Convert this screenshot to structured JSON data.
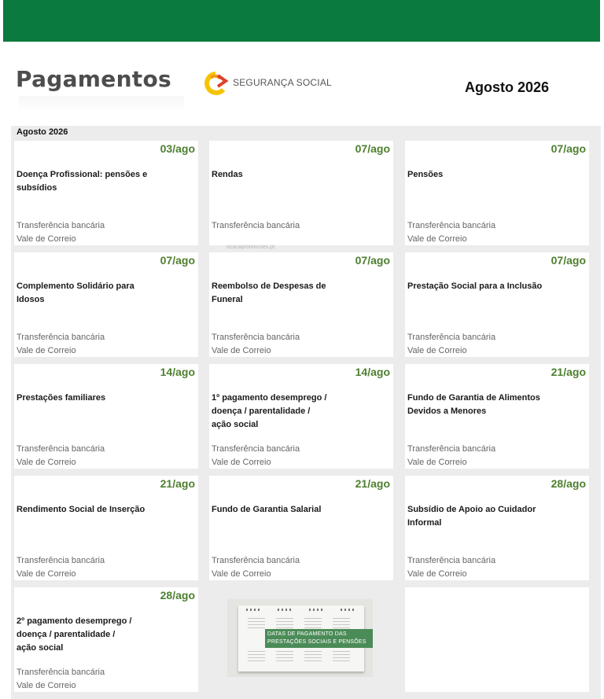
{
  "header": {
    "title": "Pagamentos",
    "logo_label": "SEGURANÇA SOCIAL",
    "month": "Agosto 2026"
  },
  "grid": {
    "label": "Agosto 2026",
    "cards": [
      {
        "date": "03/ago",
        "title": "Doença Profissional: pensões e\nsubsídios",
        "methods": [
          "Transferência bancária",
          "Vale de Correio"
        ]
      },
      {
        "date": "07/ago",
        "title": "Rendas",
        "methods": [
          "Transferência bancária"
        ]
      },
      {
        "date": "07/ago",
        "title": "Pensões",
        "methods": [
          "Transferência bancária",
          "Vale de Correio"
        ]
      },
      {
        "date": "07/ago",
        "title": "Complemento Solidário para\nIdosos",
        "methods": [
          "Transferência bancária",
          "Vale de Correio"
        ]
      },
      {
        "date": "07/ago",
        "title": "Reembolso de Despesas de\nFuneral",
        "methods": [
          "Transferência bancária",
          "Vale de Correio"
        ]
      },
      {
        "date": "07/ago",
        "title": "Prestação Social para a Inclusão",
        "methods": [
          "Transferência bancária",
          "Vale de Correio"
        ]
      },
      {
        "date": "14/ago",
        "title": "Prestações familiares",
        "methods": [
          "Transferência bancária",
          "Vale de Correio"
        ]
      },
      {
        "date": "14/ago",
        "title": "1º pagamento desemprego /\ndoença / parentalidade /\nação social",
        "methods": [
          "Transferência bancária",
          "Vale de Correio"
        ]
      },
      {
        "date": "21/ago",
        "title": "Fundo de Garantia de Alimentos\n Devidos a Menores",
        "methods": [
          "Transferência bancária",
          "Vale de Correio"
        ]
      },
      {
        "date": "21/ago",
        "title": "Rendimento Social de Inserção",
        "methods": [
          "Transferência bancária",
          "Vale de Correio"
        ]
      },
      {
        "date": "21/ago",
        "title": "Fundo de Garantia Salarial",
        "methods": [
          "Transferência bancária",
          "Vale de Correio"
        ]
      },
      {
        "date": "28/ago",
        "title": "Subsídio de Apoio ao Cuidador\n Informal",
        "methods": [
          "Transferência bancária",
          "Vale de Correio"
        ]
      },
      {
        "date": "28/ago",
        "title": "2º pagamento desemprego /\ndoença / parentalidade /\nação social",
        "methods": [
          "Transferência bancária",
          "Vale de Correio"
        ]
      }
    ]
  },
  "watermark": "ocacapromocoes.pt",
  "promo": {
    "banner_line1": "DATAS DE PAGAMENTO DAS",
    "banner_line2": "PRESTAÇÕES SOCIAIS E PENSÕES"
  },
  "colors": {
    "topbar": "#0b7a3e",
    "date_green": "#4e7f2e",
    "logo_orange": "#f39a1e",
    "logo_yellow": "#f5c400",
    "logo_red": "#e0402a"
  }
}
